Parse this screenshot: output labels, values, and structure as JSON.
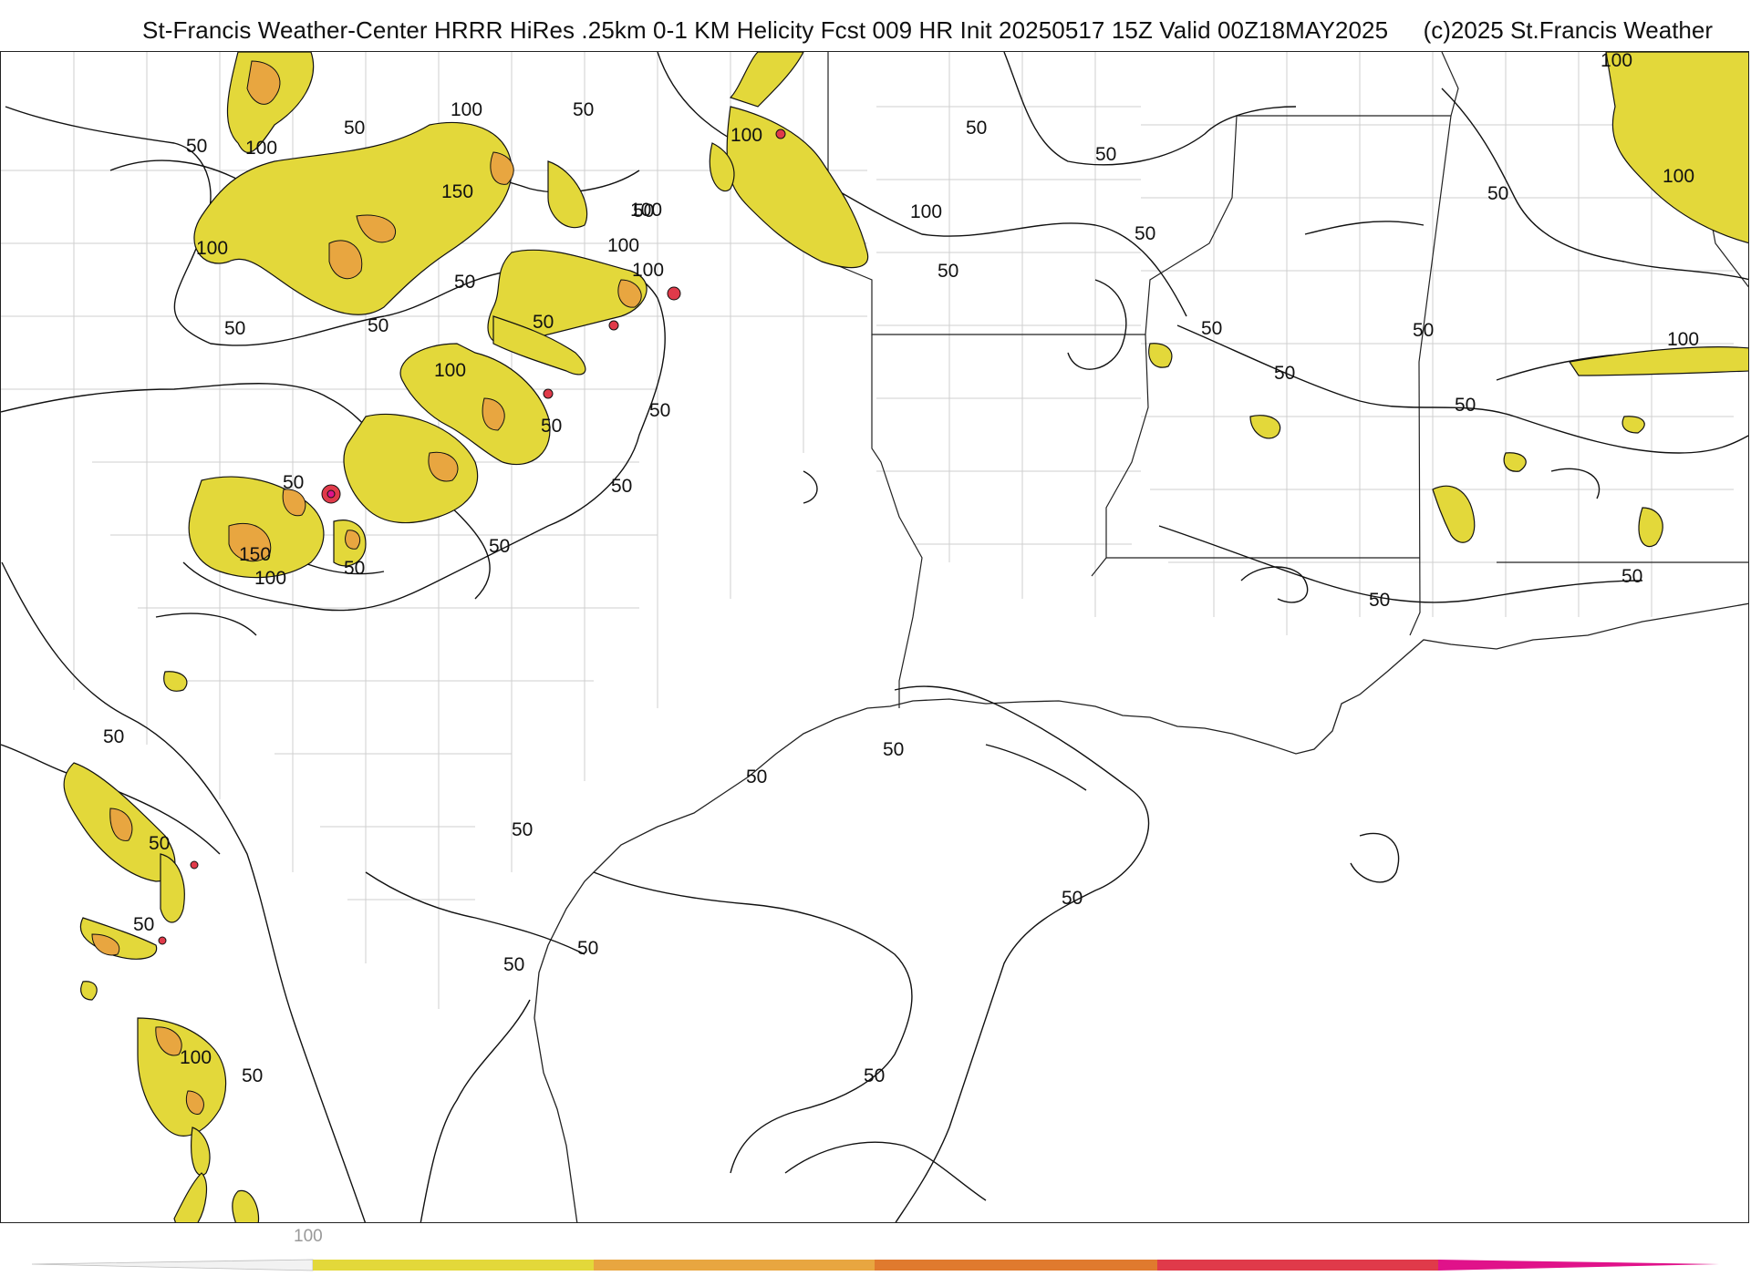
{
  "header": {
    "title": "St-Francis Weather-Center HRRR HiRes .25km 0-1 KM Helicity Fcst 009 HR Init 20250517 15Z  Valid 00Z18MAY2025",
    "copyright": "(c)2025 St.Francis Weather"
  },
  "map": {
    "contour_labels": [
      "50",
      "100",
      "150"
    ],
    "fill_colors": {
      "level_100": "#e3d83a",
      "level_150": "#e8a640",
      "level_200": "#e07a2e",
      "level_250": "#e03a4a",
      "level_300": "#e0128a"
    },
    "boundary_color": "#111111",
    "county_color": "#c8c8c8"
  },
  "colorbar": {
    "tick_label": "100",
    "segments": [
      "#e3d83a",
      "#e8a640",
      "#e07a2e",
      "#e03a4a",
      "#e0128a"
    ]
  }
}
